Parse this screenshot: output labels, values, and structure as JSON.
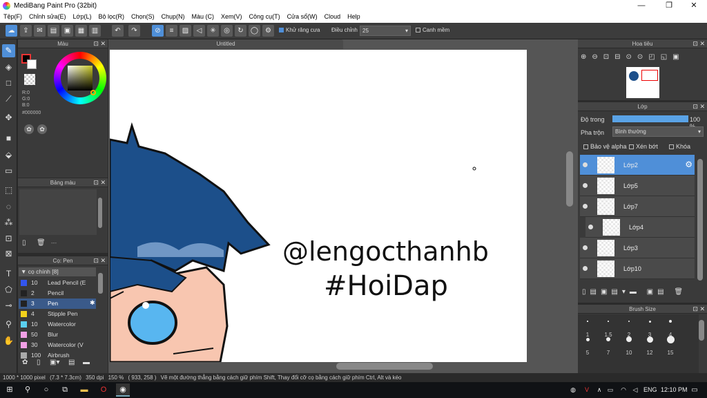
{
  "app": {
    "title": "MediBang Paint Pro (32bit)",
    "win_min": "—",
    "win_max": "❐",
    "win_close": "✕"
  },
  "menu": [
    "Tệp(F)",
    "Chỉnh sửa(E)",
    "Lớp(L)",
    "Bộ lọc(R)",
    "Chọn(S)",
    "Chụp(N)",
    "Màu (C)",
    "Xem(V)",
    "Công cụ(T)",
    "Cửa sổ(W)",
    "Cloud",
    "Help"
  ],
  "toolbar": {
    "antialias": "Khử răng cưa",
    "correction_label": "Điều chỉnh",
    "correction_value": "25",
    "snap": "Canh mềm"
  },
  "color_panel": {
    "title": "Màu",
    "r": "R:0",
    "g": "G:0",
    "b": "B:0",
    "hex": "#000000"
  },
  "palette_panel": {
    "title": "Bảng màu",
    "more": "---"
  },
  "brush_panel": {
    "title": "Cọ: Pen",
    "group": "cọ chính [8]",
    "items": [
      {
        "color": "#3355ee",
        "size": "10",
        "name": "Lead Pencil (E"
      },
      {
        "color": "#222222",
        "size": "2",
        "name": "Pencil"
      },
      {
        "color": "#222222",
        "size": "3",
        "name": "Pen"
      },
      {
        "color": "#f2d21b",
        "size": "4",
        "name": "Stipple Pen"
      },
      {
        "color": "#5ad0f0",
        "size": "10",
        "name": "Watercolor"
      },
      {
        "color": "#f2a0e6",
        "size": "50",
        "name": "Blur"
      },
      {
        "color": "#f2a0e6",
        "size": "30",
        "name": "Watercolor (V"
      },
      {
        "color": "#aaaaaa",
        "size": "100",
        "name": "Airbrush"
      }
    ]
  },
  "canvas": {
    "tab": "Untitled",
    "handwriting_line1": "@lengocthanhb",
    "handwriting_line2": "#HoiDap",
    "hair_color": "#1c4f8a",
    "eye_color": "#58b6f0",
    "skin_color": "#f8c6b0"
  },
  "nav_panel": {
    "title": "Hoa tiêu"
  },
  "layer_panel": {
    "title": "Lớp",
    "opacity_label": "Độ trong",
    "opacity_value": "100 %",
    "blend_label": "Pha trộn",
    "blend_value": "Bình thường",
    "protect_alpha": "Bảo vệ alpha",
    "clipping": "Xén bớt",
    "lock": "Khóa",
    "layers": [
      {
        "name": "Lớp2",
        "selected": true
      },
      {
        "name": "Lớp5",
        "selected": false
      },
      {
        "name": "Lớp7",
        "selected": false
      },
      {
        "name": "Lớp4",
        "selected": false
      },
      {
        "name": "Lớp3",
        "selected": false
      },
      {
        "name": "Lớp10",
        "selected": false
      }
    ]
  },
  "size_panel": {
    "title": "Brush Size",
    "sizes": [
      "1",
      "1.5",
      "2",
      "3",
      "4",
      "5",
      "7",
      "10",
      "12",
      "15"
    ]
  },
  "status": {
    "dims": "1000 * 1000 pixel",
    "physical": "(7.3 * 7.3cm)",
    "dpi": "350 dpi",
    "zoom": "150 %",
    "coords": "( 933, 258 )",
    "hint": "Vẽ một đường thẳng bằng cách giữ phím Shift, Thay đổi cỡ cọ bằng cách giữ phím Ctrl, Alt và kéo"
  },
  "taskbar": {
    "lang": "ENG",
    "time": "12:10 PM"
  },
  "colors": {
    "accent": "#4f8fd8",
    "panel": "#3a3a3a",
    "header": "#444444"
  }
}
